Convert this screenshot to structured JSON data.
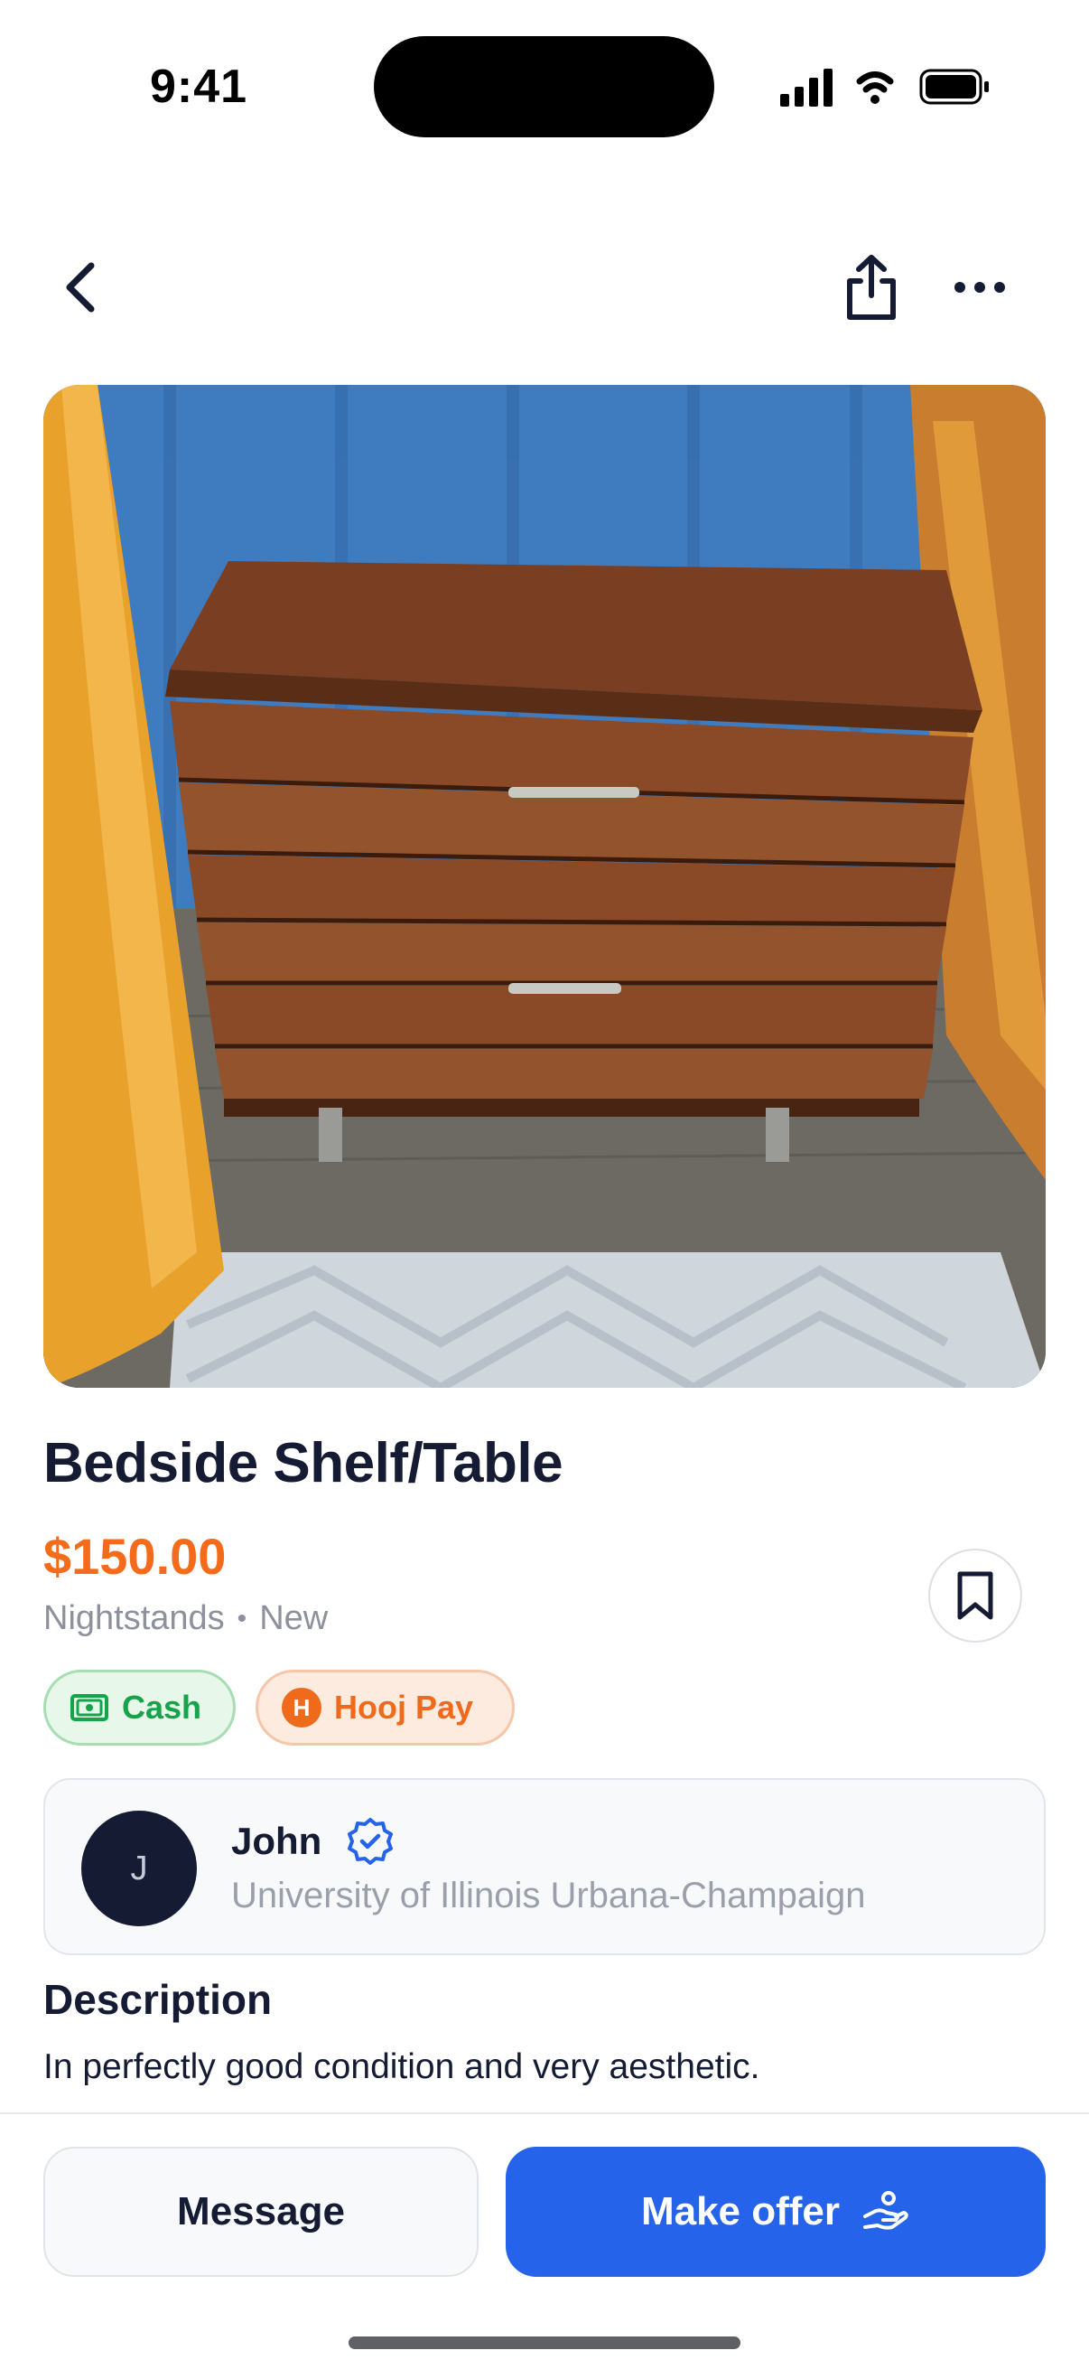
{
  "status_bar": {
    "time": "9:41",
    "icons": [
      "signal-icon",
      "wifi-icon",
      "battery-icon"
    ]
  },
  "nav": {
    "back_icon": "chevron-left-icon",
    "share_icon": "share-icon",
    "more_icon": "more-horizontal-icon"
  },
  "listing": {
    "title": "Bedside Shelf/Table",
    "price": "$150.00",
    "category": "Nightstands",
    "separator": "•",
    "condition": "New",
    "bookmark_icon": "bookmark-icon",
    "payment_methods": [
      {
        "label": "Cash",
        "icon": "cash-icon"
      },
      {
        "label": "Hooj Pay",
        "icon": "hooj-pay-icon",
        "badge": "H"
      }
    ]
  },
  "seller": {
    "initial": "J",
    "name": "John",
    "verified_icon": "verified-badge-icon",
    "school": "University of Illinois Urbana-Champaign"
  },
  "description": {
    "heading": "Description",
    "text": "In perfectly good condition and very aesthetic."
  },
  "actions": {
    "message_label": "Message",
    "offer_label": "Make offer",
    "offer_icon": "hand-offer-icon"
  },
  "colors": {
    "price": "#f46b1b",
    "primary_button": "#2563eb",
    "cash_green": "#16a34a",
    "hooj_orange": "#ef6a1a",
    "text_dark": "#141b33",
    "muted": "#8c919c"
  }
}
